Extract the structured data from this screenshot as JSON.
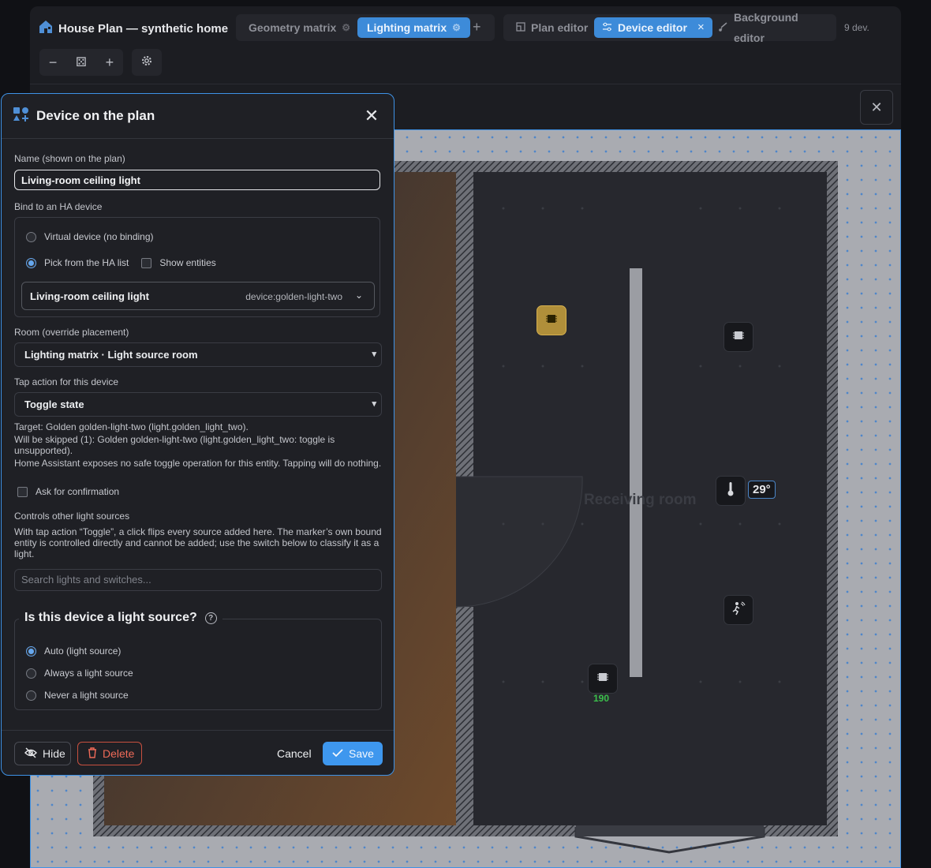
{
  "header": {
    "app_title": "House Plan — synthetic home",
    "tabs": [
      {
        "label": "Geometry matrix"
      },
      {
        "label": "Lighting matrix"
      }
    ],
    "add_tab": "+",
    "modes": [
      {
        "label": "Plan editor"
      },
      {
        "label": "Device editor",
        "close": "×"
      },
      {
        "label": "Background editor"
      }
    ],
    "device_count": "9 dev."
  },
  "toolbar": {
    "zoom_out": "−",
    "zoom_reset": "⚄",
    "zoom_in": "+"
  },
  "plan": {
    "room_label": "Receiving room",
    "temperature": "29°",
    "sensor_value": "190"
  },
  "dialog": {
    "title": "Device on the plan",
    "name_label": "Name (shown on the plan)",
    "name_value": "Living-room ceiling light",
    "bind_label": "Bind to an HA device",
    "bind_virtual": "Virtual device (no binding)",
    "bind_pick": "Pick from the HA list",
    "show_entities": "Show entities",
    "ha_device_name": "Living-room ceiling light",
    "ha_device_id": "device:golden-light-two",
    "room_label": "Room (override placement)",
    "room_value": "Lighting matrix · Light source room",
    "tap_label": "Tap action for this device",
    "tap_value": "Toggle state",
    "target_line": "Target: Golden golden-light-two (light.golden_light_two).",
    "skipped_line": "Will be skipped (1): Golden golden-light-two (light.golden_light_two: toggle is unsupported).",
    "no_toggle_line": "Home Assistant exposes no safe toggle operation for this entity. Tapping will do nothing.",
    "confirm_label": "Ask for confirmation",
    "controls_label": "Controls other light sources",
    "controls_desc": "With tap action “Toggle”, a click flips every source added here. The marker’s own bound entity is controlled directly and cannot be added; use the switch below to classify it as a light.",
    "search_placeholder": "Search lights and switches...",
    "light_source_title": "Is this device a light source?",
    "ls_auto": "Auto (light source)",
    "ls_always": "Always a light source",
    "ls_never": "Never a light source",
    "hide": "Hide",
    "delete": "Delete",
    "cancel": "Cancel",
    "save": "Save"
  }
}
